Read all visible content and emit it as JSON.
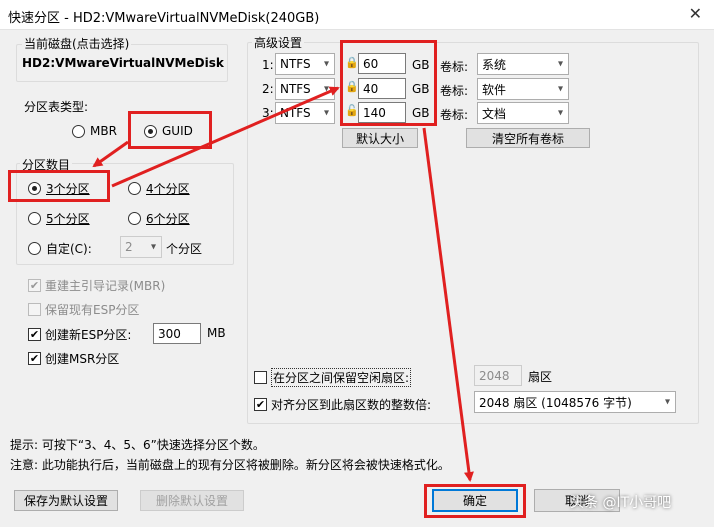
{
  "window": {
    "title": "快速分区 - HD2:VMwareVirtualNVMeDisk(240GB)",
    "close_glyph": "✕"
  },
  "disk": {
    "group_label": "当前磁盘(点击选择)",
    "value": "HD2:VMwareVirtualNVMeDisk"
  },
  "partition_table": {
    "label": "分区表类型:",
    "options": [
      "MBR",
      "GUID"
    ],
    "selected": "GUID"
  },
  "partition_count": {
    "label": "分区数目",
    "options": [
      "3个分区",
      "4个分区",
      "5个分区",
      "6个分区",
      "自定(C):"
    ],
    "selected": "3个分区",
    "custom_value": "2",
    "custom_suffix": "个分区"
  },
  "options": {
    "rebuild_mbr": "重建主引导记录(MBR)",
    "keep_esp": "保留现有ESP分区",
    "create_esp": "创建新ESP分区:",
    "esp_size": "300",
    "esp_unit": "MB",
    "create_msr": "创建MSR分区"
  },
  "advanced": {
    "label": "高级设置",
    "rows": [
      {
        "index": "1:",
        "fs": "NTFS",
        "size": "60",
        "unit": "GB",
        "vol_label_title": "卷标:",
        "vol_label": "系统"
      },
      {
        "index": "2:",
        "fs": "NTFS",
        "size": "40",
        "unit": "GB",
        "vol_label_title": "卷标:",
        "vol_label": "软件"
      },
      {
        "index": "3:",
        "fs": "NTFS",
        "size": "140",
        "unit": "GB",
        "vol_label_title": "卷标:",
        "vol_label": "文档"
      }
    ],
    "default_size_button": "默认大小",
    "clear_labels_button": "清空所有卷标",
    "free_sector_label": "在分区之间保留空闲扇区:",
    "free_sector_value": "2048",
    "free_sector_unit": "扇区",
    "align_label": "对齐分区到此扇区数的整数倍:",
    "align_value": "2048 扇区 (1048576 字节)"
  },
  "hints": {
    "tip": "提示: 可按下“3、4、5、6”快速选择分区个数。",
    "note": "注意: 此功能执行后，当前磁盘上的现有分区将被删除。新分区将会被快速格式化。"
  },
  "buttons": {
    "save_default": "保存为默认设置",
    "delete_default": "删除默认设置",
    "ok": "确定",
    "cancel": "取消"
  },
  "watermark": "头条 @IT小哥吧",
  "colors": {
    "annotation_red": "#e02020",
    "focus_blue": "#0078d7"
  }
}
